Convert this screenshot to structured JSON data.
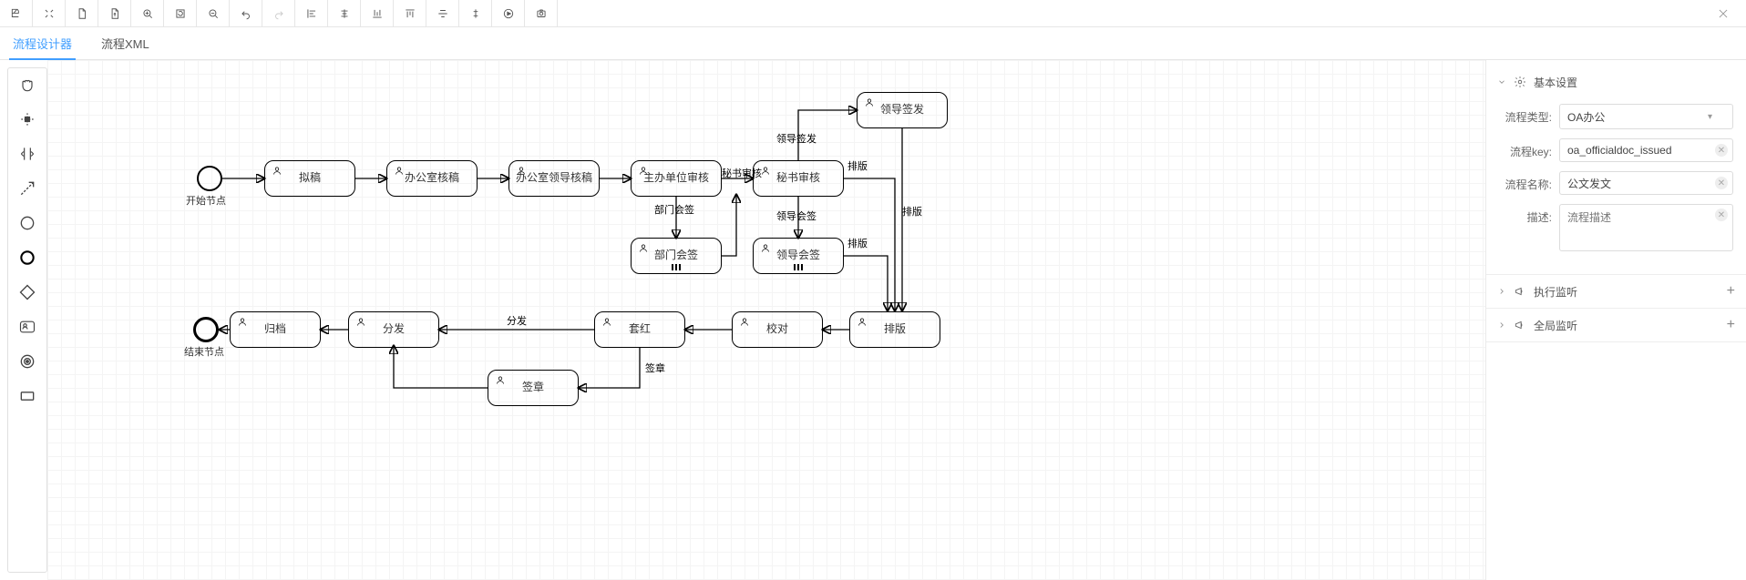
{
  "toolbar": {
    "buttons": [
      "save",
      "fit",
      "new-doc",
      "open-doc",
      "zoom-in",
      "refresh",
      "zoom-out",
      "undo",
      "redo",
      "align-left",
      "align-center",
      "align-bottom",
      "align-top",
      "align-h-center",
      "distribute-v",
      "play",
      "snapshot"
    ]
  },
  "close": "✕",
  "tabs": {
    "designer": "流程设计器",
    "xml": "流程XML"
  },
  "palette": [
    "grab",
    "select",
    "space",
    "connect",
    "start",
    "end",
    "gateway",
    "user-task",
    "service-task",
    "subprocess"
  ],
  "nodes": {
    "start_label": "开始节点",
    "end_label": "结束节点",
    "t_draft": "拟稿",
    "t_office_review": "办公室核稿",
    "t_office_lead_review": "办公室领导核稿",
    "t_main_dept_review": "主办单位审核",
    "t_dept_sign": "部门会签",
    "t_sec_review": "秘书审核",
    "t_lead_sign": "领导会签",
    "t_lead_issue": "领导签发",
    "t_typeset": "排版",
    "t_proof": "校对",
    "t_cover": "套红",
    "t_seal": "签章",
    "t_distribute": "分发",
    "t_archive": "归档"
  },
  "edge_labels": {
    "sec_review": "秘书审核",
    "dept_sign": "部门会签",
    "lead_issue": "领导签发",
    "lead_sign": "领导会签",
    "typeset1": "排版",
    "typeset2": "排版",
    "typeset3": "排版",
    "distribute": "分发",
    "seal": "签章"
  },
  "props": {
    "basic_title": "基本设置",
    "exec_title": "执行监听",
    "global_title": "全局监听",
    "type_label": "流程类型:",
    "type_value": "OA办公",
    "key_label": "流程key:",
    "key_value": "oa_officialdoc_issued",
    "name_label": "流程名称:",
    "name_value": "公文发文",
    "desc_label": "描述:",
    "desc_placeholder": "流程描述"
  }
}
